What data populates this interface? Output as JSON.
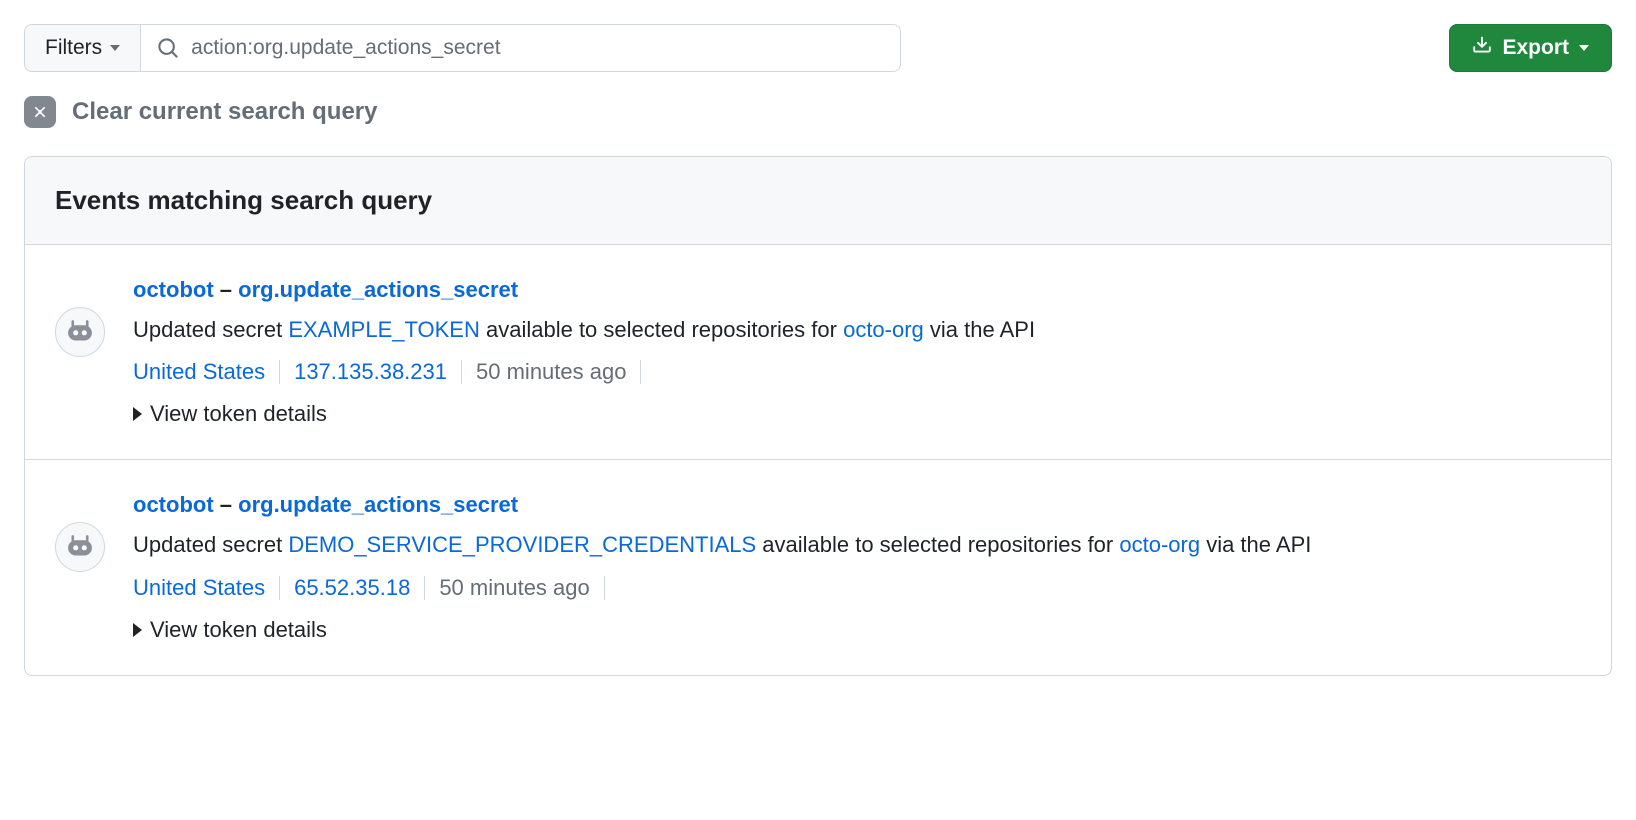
{
  "toolbar": {
    "filters_label": "Filters",
    "search_value": "action:org.update_actions_secret",
    "export_label": "Export"
  },
  "clear": {
    "label": "Clear current search query"
  },
  "panel": {
    "header": "Events matching search query"
  },
  "events": [
    {
      "actor": "octobot",
      "separator": " – ",
      "action": "org.update_actions_secret",
      "desc_prefix": "Updated secret ",
      "secret_name": "EXAMPLE_TOKEN",
      "desc_mid": " available to selected repositories for ",
      "org": "octo-org",
      "desc_suffix": " via the API",
      "location": "United States",
      "ip": "137.135.38.231",
      "time": "50 minutes ago",
      "details_label": "View token details"
    },
    {
      "actor": "octobot",
      "separator": " – ",
      "action": "org.update_actions_secret",
      "desc_prefix": "Updated secret ",
      "secret_name": "DEMO_SERVICE_PROVIDER_CREDENTIALS",
      "desc_mid": " available to selected repositories for ",
      "org": "octo-org",
      "desc_suffix": " via the API",
      "location": "United States",
      "ip": "65.52.35.18",
      "time": "50 minutes ago",
      "details_label": "View token details"
    }
  ]
}
